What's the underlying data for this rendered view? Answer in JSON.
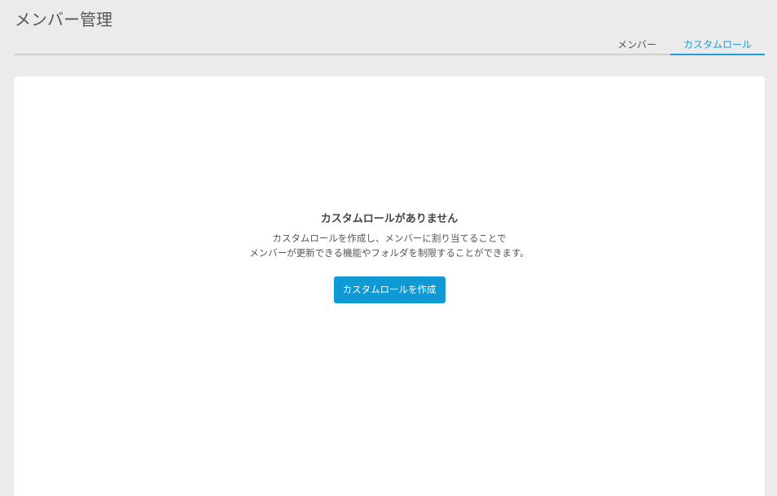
{
  "header": {
    "title": "メンバー管理"
  },
  "tabs": [
    {
      "label": "メンバー",
      "active": false
    },
    {
      "label": "カスタムロール",
      "active": true
    }
  ],
  "empty_state": {
    "title": "カスタムロールがありません",
    "description_line1": "カスタムロールを作成し、メンバーに割り当てることで",
    "description_line2": "メンバーが更新できる機能やフォルダを制限することができます。",
    "button_label": "カスタムロールを作成"
  },
  "colors": {
    "accent": "#1a9fd9",
    "button": "#0f9ad6",
    "background": "#ebebeb",
    "card": "#ffffff"
  }
}
